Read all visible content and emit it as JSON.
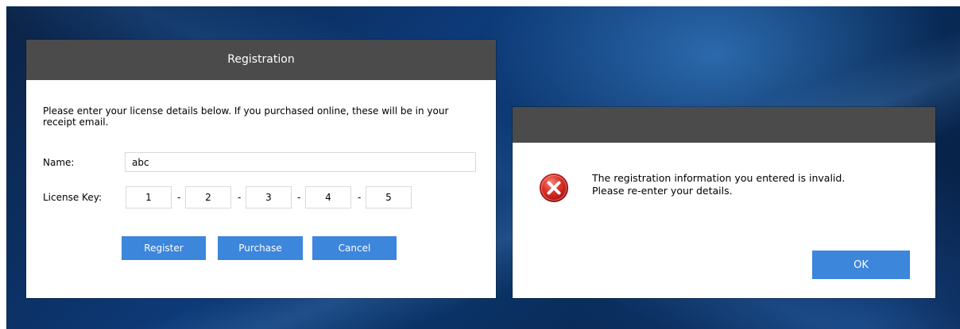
{
  "registration_dialog": {
    "title": "Registration",
    "instructions": "Please enter your license details below. If you purchased online, these will be in your receipt email.",
    "name_label": "Name:",
    "name_value": "abc",
    "license_key_label": "License Key:",
    "license_key_parts": [
      "1",
      "2",
      "3",
      "4",
      "5"
    ],
    "separator": "-",
    "buttons": {
      "register": "Register",
      "purchase": "Purchase",
      "cancel": "Cancel"
    }
  },
  "error_dialog": {
    "title": "",
    "icon": "error-icon",
    "message_line1": "The registration information you entered is invalid.",
    "message_line2": "Please re-enter your details.",
    "ok_label": "OK"
  },
  "colors": {
    "titlebar": "#4b4b4b",
    "button": "#3c86dc",
    "error_red": "#d9262a",
    "desktop": "#0d3a78"
  }
}
